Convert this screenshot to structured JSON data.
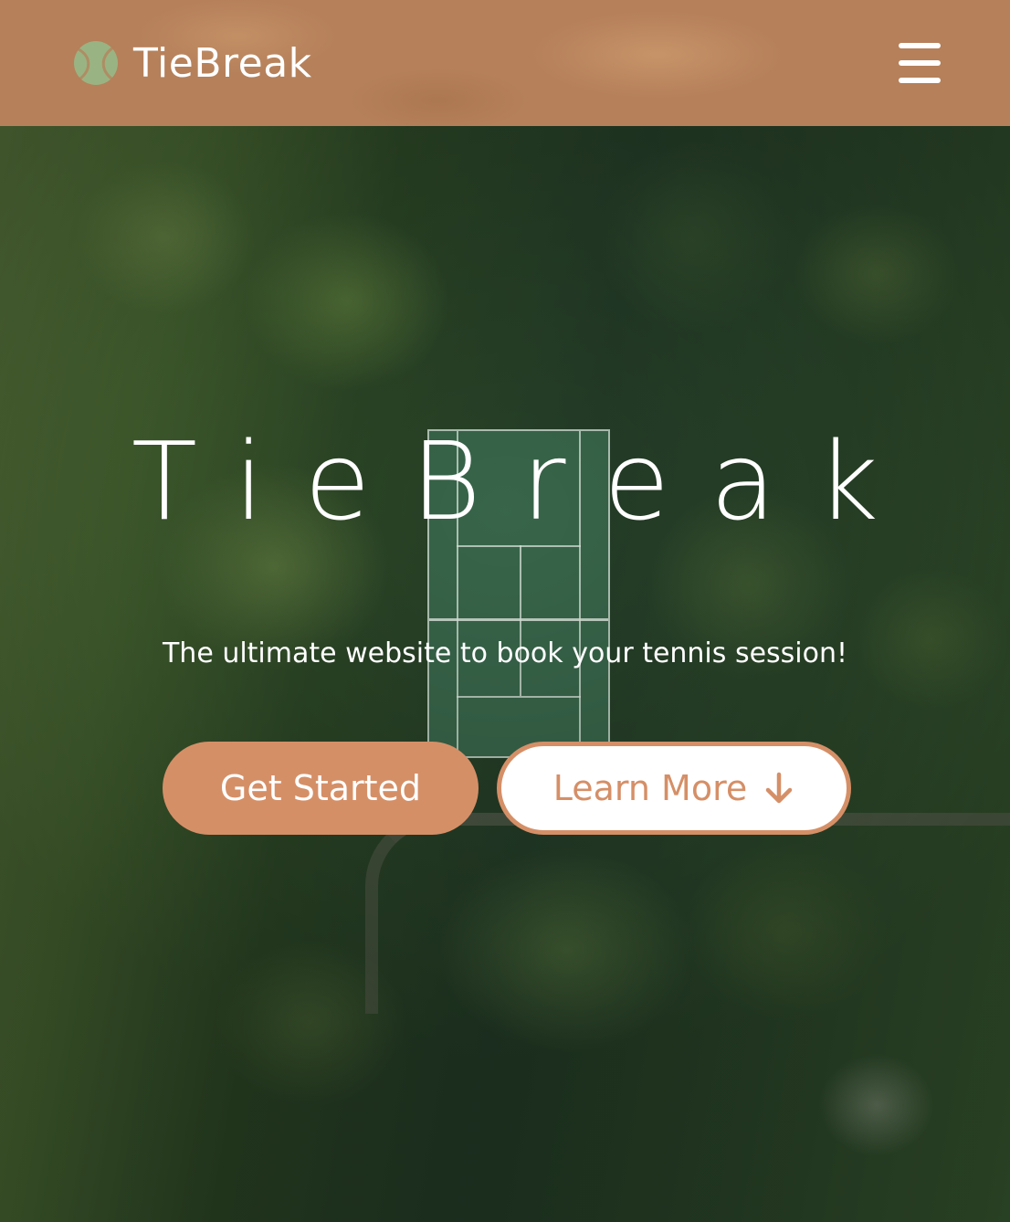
{
  "header": {
    "brand_name": "TieBreak",
    "logo_icon": "tennis-ball-icon",
    "menu_icon": "hamburger-menu-icon"
  },
  "hero": {
    "title": "TieBreak",
    "subtitle": "The ultimate website to book your tennis session!",
    "primary_button_label": "Get Started",
    "secondary_button_label": "Learn More",
    "secondary_button_icon": "arrow-down-icon"
  },
  "colors": {
    "header_background": "#b5805a",
    "accent": "#d58f67",
    "logo_ball": "#9ab382",
    "text_light": "#ffffff"
  }
}
